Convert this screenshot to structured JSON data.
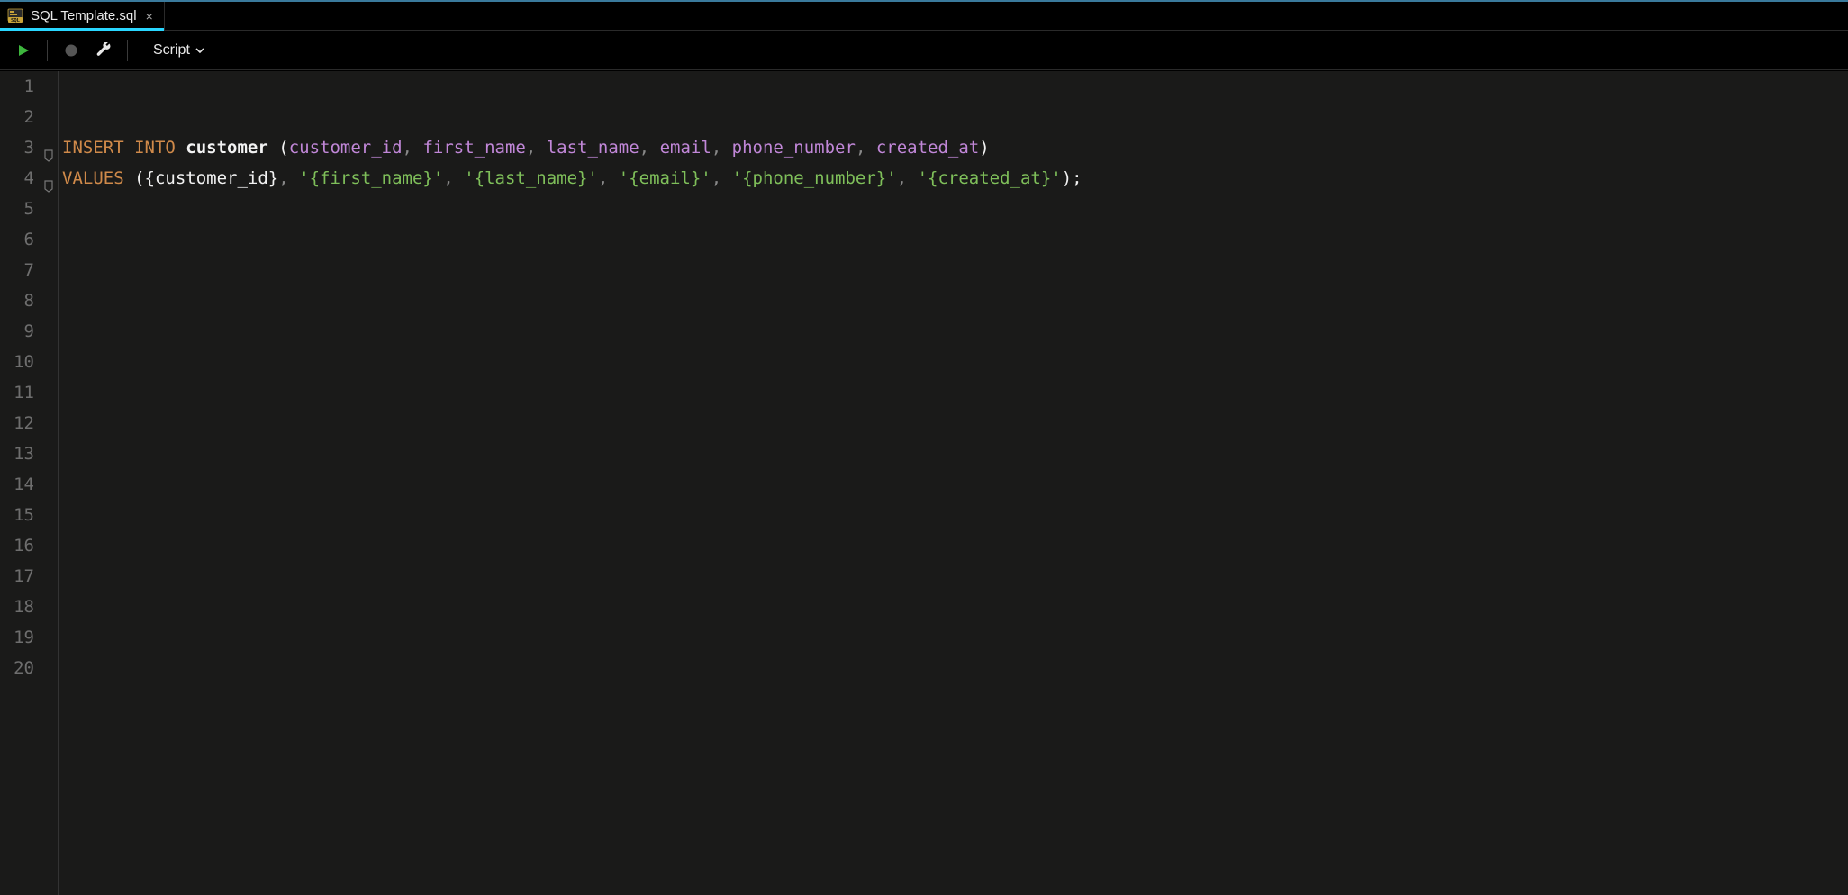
{
  "tab": {
    "filename": "SQL Template.sql",
    "close_glyph": "×"
  },
  "toolbar": {
    "run_mode_label": "Script"
  },
  "editor": {
    "visible_line_count": 20,
    "code_lines": [
      {
        "n": 1,
        "fold": "",
        "tokens": []
      },
      {
        "n": 2,
        "fold": "",
        "tokens": []
      },
      {
        "n": 3,
        "fold": "open",
        "tokens": [
          {
            "c": "kw",
            "t": "INSERT INTO"
          },
          {
            "c": "ppl",
            "t": " "
          },
          {
            "c": "tbl",
            "t": "customer"
          },
          {
            "c": "ppl",
            "t": " ("
          },
          {
            "c": "col",
            "t": "customer_id"
          },
          {
            "c": "cm",
            "t": ", "
          },
          {
            "c": "col",
            "t": "first_name"
          },
          {
            "c": "cm",
            "t": ", "
          },
          {
            "c": "col",
            "t": "last_name"
          },
          {
            "c": "cm",
            "t": ", "
          },
          {
            "c": "col",
            "t": "email"
          },
          {
            "c": "cm",
            "t": ", "
          },
          {
            "c": "col",
            "t": "phone_number"
          },
          {
            "c": "cm",
            "t": ", "
          },
          {
            "c": "col",
            "t": "created_at"
          },
          {
            "c": "ppl",
            "t": ")"
          }
        ]
      },
      {
        "n": 4,
        "fold": "close",
        "tokens": [
          {
            "c": "kw",
            "t": "VALUES"
          },
          {
            "c": "ppl",
            "t": " ("
          },
          {
            "c": "ppl",
            "t": "{customer_id}"
          },
          {
            "c": "cm",
            "t": ", "
          },
          {
            "c": "str",
            "t": "'{first_name}'"
          },
          {
            "c": "cm",
            "t": ", "
          },
          {
            "c": "str",
            "t": "'{last_name}'"
          },
          {
            "c": "cm",
            "t": ", "
          },
          {
            "c": "str",
            "t": "'{email}'"
          },
          {
            "c": "cm",
            "t": ", "
          },
          {
            "c": "str",
            "t": "'{phone_number}'"
          },
          {
            "c": "cm",
            "t": ", "
          },
          {
            "c": "str",
            "t": "'{created_at}'"
          },
          {
            "c": "ppl",
            "t": ");"
          }
        ]
      },
      {
        "n": 5,
        "fold": "",
        "tokens": []
      },
      {
        "n": 6,
        "fold": "",
        "tokens": []
      },
      {
        "n": 7,
        "fold": "",
        "tokens": []
      },
      {
        "n": 8,
        "fold": "",
        "tokens": []
      },
      {
        "n": 9,
        "fold": "",
        "tokens": []
      },
      {
        "n": 10,
        "fold": "",
        "tokens": []
      },
      {
        "n": 11,
        "fold": "",
        "tokens": []
      },
      {
        "n": 12,
        "fold": "",
        "tokens": []
      },
      {
        "n": 13,
        "fold": "",
        "tokens": []
      },
      {
        "n": 14,
        "fold": "",
        "tokens": []
      },
      {
        "n": 15,
        "fold": "",
        "tokens": []
      },
      {
        "n": 16,
        "fold": "",
        "tokens": []
      },
      {
        "n": 17,
        "fold": "",
        "tokens": []
      },
      {
        "n": 18,
        "fold": "",
        "tokens": []
      },
      {
        "n": 19,
        "fold": "",
        "tokens": []
      },
      {
        "n": 20,
        "fold": "",
        "tokens": []
      }
    ]
  }
}
